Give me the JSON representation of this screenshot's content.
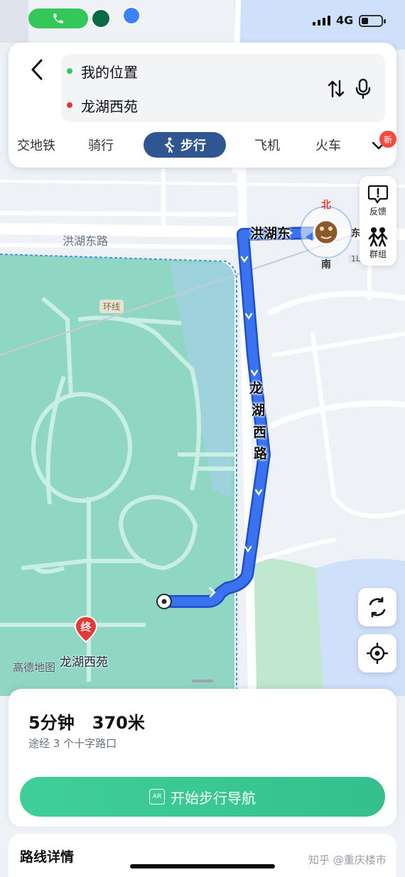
{
  "status_bar": {
    "network": "4G",
    "battery_level": 0.35,
    "colors": {
      "call": "#34c759"
    },
    "icons": [
      "phone-icon",
      "starbucks-app-icon",
      "transit-app-icon"
    ]
  },
  "route": {
    "origin": "我的位置",
    "destination": "龙湖西苑",
    "origin_color": "#34c759",
    "destination_color": "#e53935"
  },
  "tabs": [
    {
      "label": "交地铁",
      "active": false
    },
    {
      "label": "骑行",
      "active": false
    },
    {
      "label": "步行",
      "active": true
    },
    {
      "label": "飞机",
      "active": false
    },
    {
      "label": "火车",
      "active": false
    }
  ],
  "new_badge": "新",
  "side_tools": {
    "feedback": "反馈",
    "group": "群组"
  },
  "map": {
    "road_east": "洪湖东路",
    "route_road_top": "洪湖东",
    "route_road_vertical": [
      "龙",
      "湖",
      "西",
      "路"
    ],
    "ring_label": "环线",
    "line_label": "1L",
    "compass": {
      "north": "北",
      "south": "南",
      "east": "东"
    },
    "destination_pin": "终",
    "destination_label": "龙湖西苑",
    "map_logo": "高德地图",
    "colors": {
      "route": "#3a73f0",
      "park": "#8fd7c3",
      "water": "#cfe0fa"
    }
  },
  "summary": {
    "time_distance": "5分钟   370米",
    "via": "途经 3 个十字路口",
    "start_button": "开始步行导航",
    "ar_badge": "AR"
  },
  "route_detail_title": "路线详情",
  "watermark": "知乎 @重庆楼市"
}
